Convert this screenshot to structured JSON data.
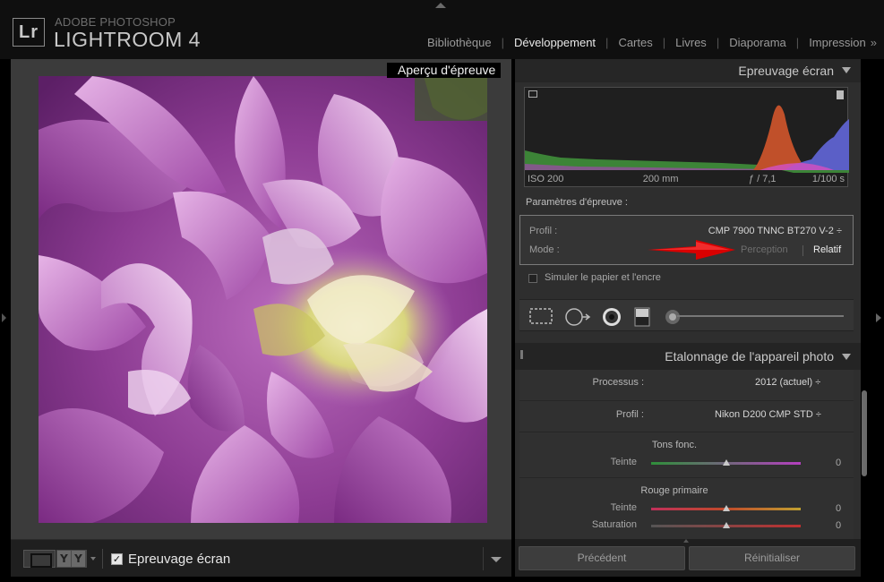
{
  "app": {
    "brand_top": "ADOBE PHOTOSHOP",
    "brand_main": "LIGHTROOM 4",
    "logo": "Lr"
  },
  "modules": [
    {
      "label": "Bibliothèque",
      "active": false
    },
    {
      "label": "Développement",
      "active": true
    },
    {
      "label": "Cartes",
      "active": false
    },
    {
      "label": "Livres",
      "active": false
    },
    {
      "label": "Diaporama",
      "active": false
    },
    {
      "label": "Impression",
      "active": false
    }
  ],
  "modules_more": "»",
  "preview": {
    "label": "Aperçu d'épreuve"
  },
  "toolbar": {
    "yy_left": "Y",
    "yy_right": "Y",
    "softproof_label": "Epreuvage écran",
    "softproof_checked": true
  },
  "softproof_panel": {
    "title": "Epreuvage écran",
    "histogram_info": [
      "ISO 200",
      "200 mm",
      "ƒ / 7,1",
      "1/100 s"
    ],
    "params_title": "Paramètres d'épreuve :",
    "profile_label": "Profil :",
    "profile_value": "CMP 7900 TNNC BT270 V-2 ÷",
    "mode_label": "Mode :",
    "mode_options": [
      "Perception",
      "Relatif"
    ],
    "mode_selected": "Relatif",
    "simulate_label": "Simuler le papier et l'encre",
    "simulate_checked": false
  },
  "calibration_panel": {
    "title": "Etalonnage de l'appareil photo",
    "process_label": "Processus :",
    "process_value": "2012 (actuel) ÷",
    "profile_label": "Profil :",
    "profile_value": "Nikon D200 CMP STD ÷",
    "shadows": {
      "title": "Tons fonc.",
      "sliders": [
        {
          "label": "Teinte",
          "value": "0",
          "position": 0.5
        }
      ]
    },
    "red_primary": {
      "title": "Rouge primaire",
      "sliders": [
        {
          "label": "Teinte",
          "value": "0",
          "position": 0.5
        },
        {
          "label": "Saturation",
          "value": "0",
          "position": 0.5
        }
      ]
    }
  },
  "bottom": {
    "previous": "Précédent",
    "reset": "Réinitialiser"
  },
  "colors": {
    "active_module": "#e8e8e8",
    "arrow_red": "#d90000",
    "hist_red": "#c0502a",
    "hist_blue": "#5b5fc7",
    "hist_green": "#3f8f3a",
    "hist_magenta": "#b03cc0"
  }
}
